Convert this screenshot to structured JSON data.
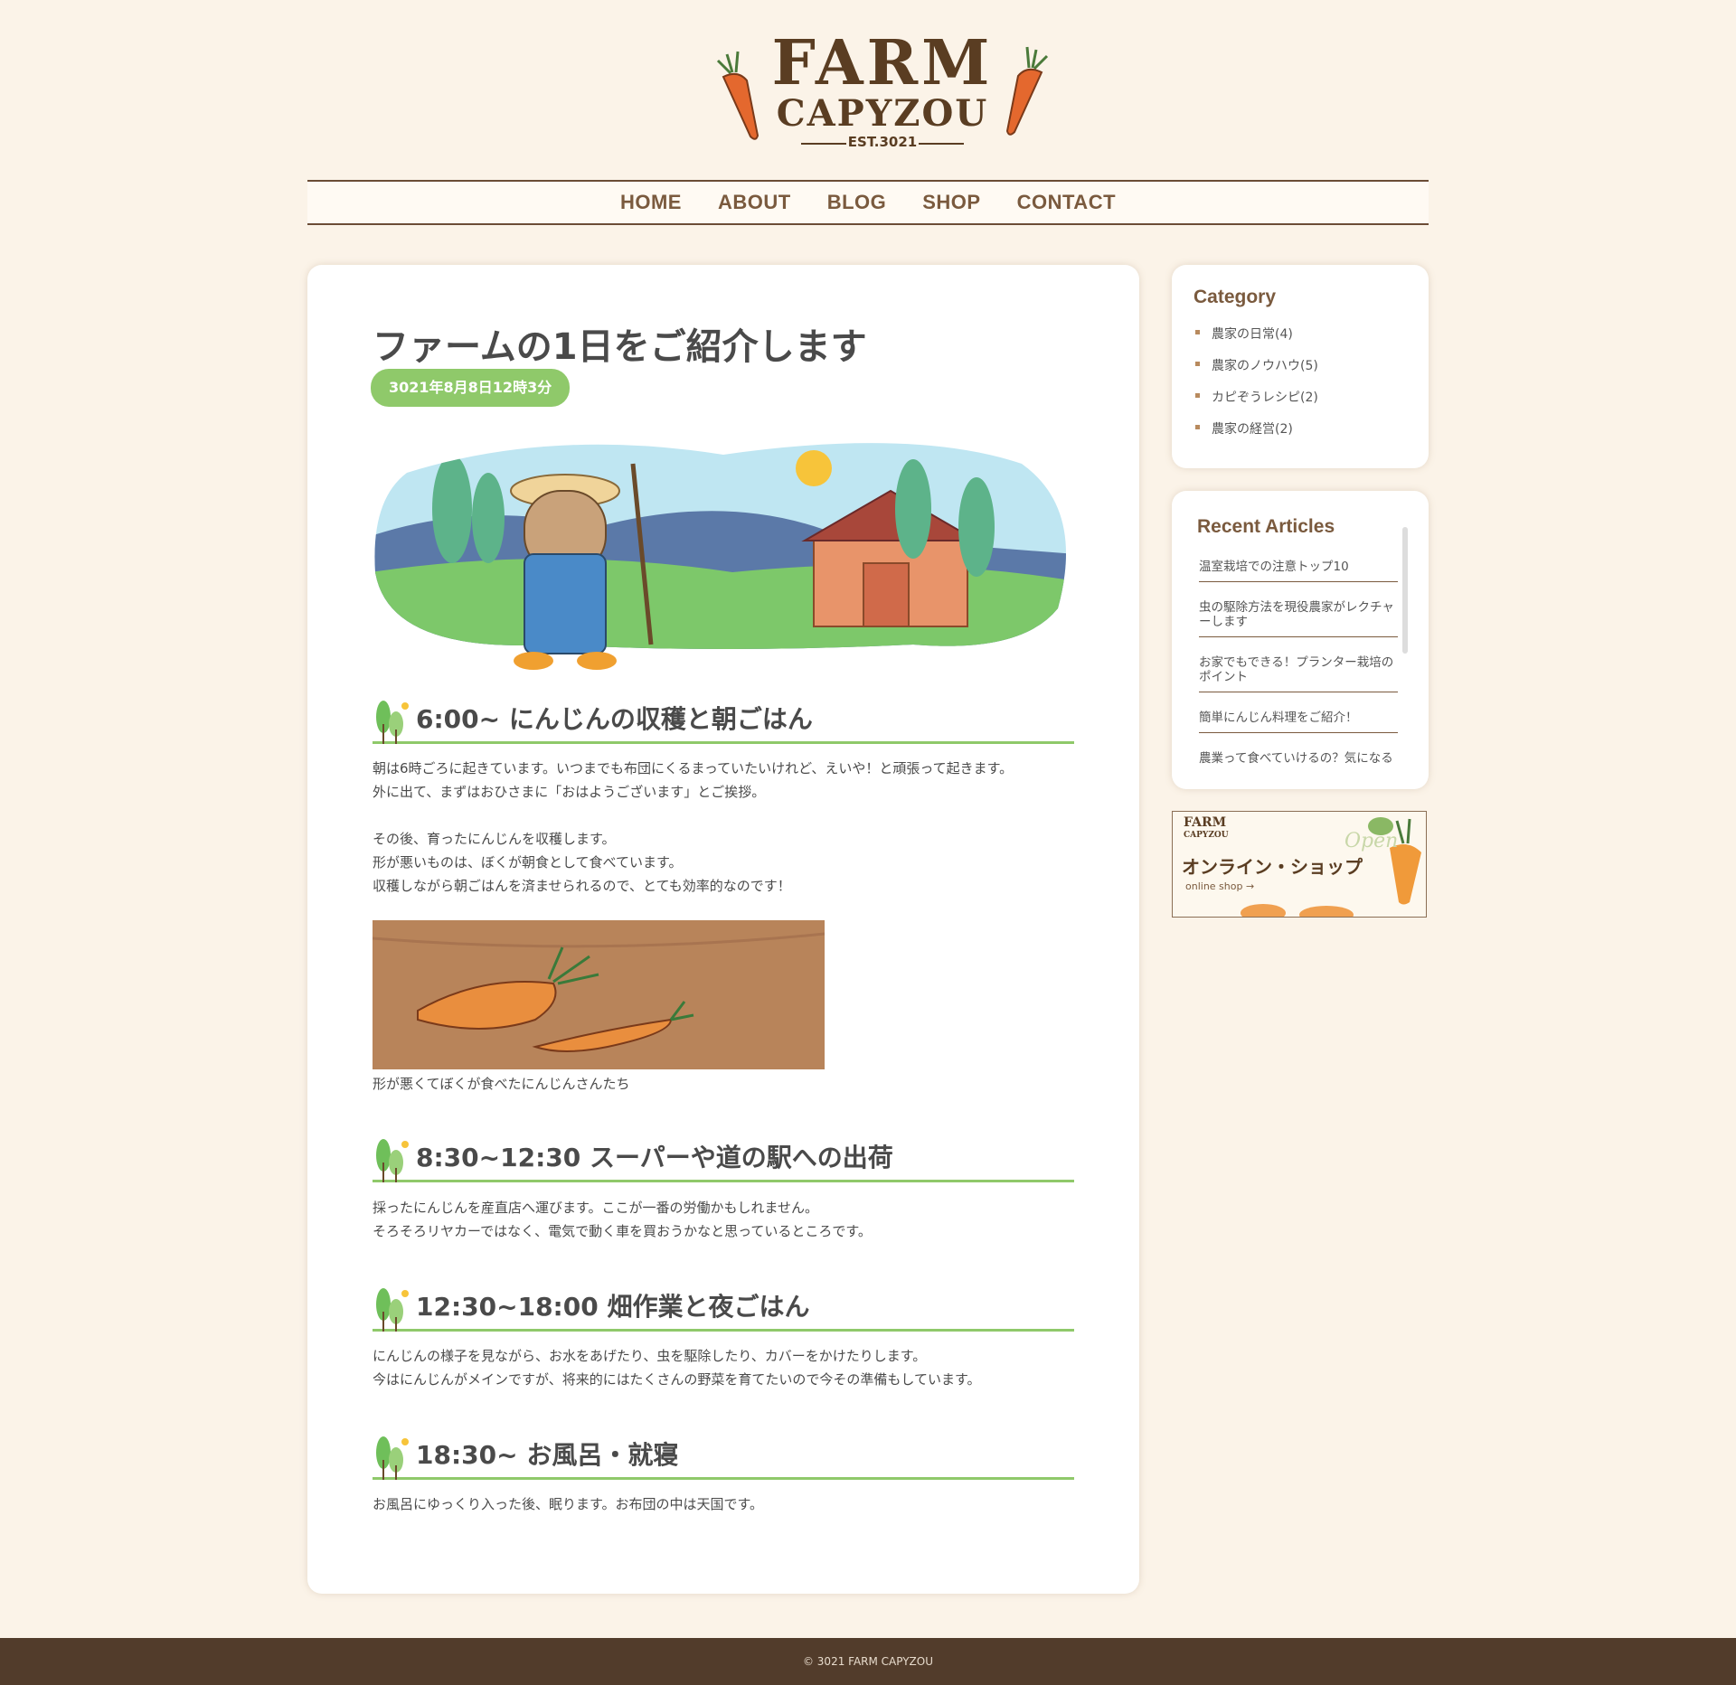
{
  "logo": {
    "line1": "FARM",
    "line2": "CAPYZOU",
    "est": "EST.3021"
  },
  "nav": {
    "items": [
      "HOME",
      "ABOUT",
      "BLOG",
      "SHOP",
      "CONTACT"
    ]
  },
  "article": {
    "title": "ファームの1日をご紹介します",
    "date": "3021年8月8日12時3分",
    "sections": [
      {
        "heading": "6:00~ にんじんの収穫と朝ごはん",
        "body": "朝は6時ごろに起きています。いつまでも布団にくるまっていたいけれど、えいや！と頑張って起きます。\n外に出て、まずはおひさまに「おはようございます」とご挨拶。\n\nその後、育ったにんじんを収穫します。\n形が悪いものは、ぼくが朝食として食べています。\n収穫しながら朝ごはんを済ませられるので、とても効率的なのです！"
      },
      {
        "heading": "8:30~12:30 スーパーや道の駅への出荷",
        "body": "採ったにんじんを産直店へ運びます。ここが一番の労働かもしれません。\nそろそろリヤカーではなく、電気で動く車を買おうかなと思っているところです。"
      },
      {
        "heading": "12:30~18:00 畑作業と夜ごはん",
        "body": "にんじんの様子を見ながら、お水をあげたり、虫を駆除したり、カバーをかけたりします。\n今はにんじんがメインですが、将来的にはたくさんの野菜を育てたいので今その準備もしています。"
      },
      {
        "heading": "18:30~ お風呂・就寝",
        "body": "お風呂にゆっくり入った後、眠ります。お布団の中は天国です。"
      }
    ],
    "image_caption": "形が悪くてぼくが食べたにんじんさんたち"
  },
  "sidebar": {
    "category_title": "Category",
    "categories": [
      "農家の日常(4)",
      "農家のノウハウ(5)",
      "カピぞうレシピ(2)",
      "農家の経営(2)"
    ],
    "recent_title": "Recent Articles",
    "recent": [
      "温室栽培での注意トップ10",
      "虫の駆除方法を現役農家がレクチャーします",
      "お家でもできる！プランター栽培のポイント",
      "簡単にんじん料理をご紹介！",
      "農業って食べていけるの？気になる"
    ],
    "banner": {
      "logo_line1": "FARM",
      "logo_line2": "CAPYZOU",
      "title": "オンライン・ショップ",
      "subtitle": "online shop →",
      "open": "Open"
    }
  },
  "footer": {
    "text": "© 3021  FARM CAPYZOU"
  },
  "colors": {
    "background": "#fbf3e8",
    "brown": "#7a5a3e",
    "green": "#8fc96a",
    "footer": "#523c2b"
  }
}
